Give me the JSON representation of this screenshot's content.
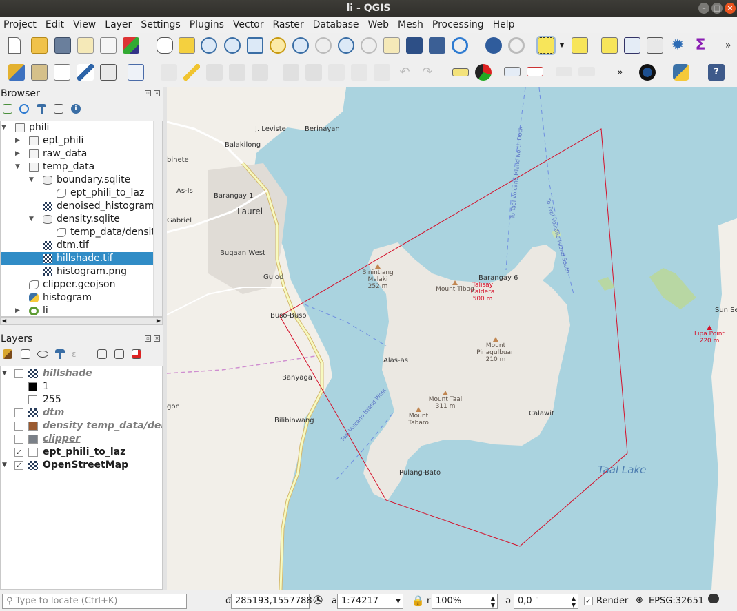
{
  "window": {
    "title": "li - QGIS"
  },
  "menu": [
    "Project",
    "Edit",
    "View",
    "Layer",
    "Settings",
    "Plugins",
    "Vector",
    "Raster",
    "Database",
    "Web",
    "Mesh",
    "Processing",
    "Help"
  ],
  "browser": {
    "title": "Browser",
    "items": [
      {
        "label": "phili",
        "icon": "folder-icon",
        "expand": "▼"
      },
      {
        "label": "ept_phili",
        "icon": "folder-icon",
        "expand": "▶"
      },
      {
        "label": "raw_data",
        "icon": "folder-icon",
        "expand": "▶"
      },
      {
        "label": "temp_data",
        "icon": "folder-icon",
        "expand": "▼"
      },
      {
        "label": "boundary.sqlite",
        "icon": "database-icon",
        "expand": "▼"
      },
      {
        "label": "ept_phili_to_laz",
        "icon": "polygon-layer-icon",
        "expand": ""
      },
      {
        "label": "denoised_histogram",
        "icon": "raster-icon",
        "expand": ""
      },
      {
        "label": "density.sqlite",
        "icon": "database-icon",
        "expand": "▼"
      },
      {
        "label": "temp_data/density",
        "icon": "polygon-layer-icon",
        "expand": ""
      },
      {
        "label": "dtm.tif",
        "icon": "raster-icon",
        "expand": ""
      },
      {
        "label": "hillshade.tif",
        "icon": "raster-icon",
        "expand": "",
        "selected": true
      },
      {
        "label": "histogram.png",
        "icon": "raster-icon",
        "expand": ""
      },
      {
        "label": "clipper.geojson",
        "icon": "polygon-layer-icon",
        "expand": ""
      },
      {
        "label": "histogram",
        "icon": "python-icon",
        "expand": ""
      },
      {
        "label": "li",
        "icon": "qgis-icon",
        "expand": "▶"
      }
    ]
  },
  "layers": {
    "title": "Layers",
    "items": [
      {
        "label": "hillshade",
        "checked": false,
        "style": "italic bold",
        "icon": "raster-icon"
      },
      {
        "label": "1",
        "legend": "#000000"
      },
      {
        "label": "255",
        "legend": "#ffffff"
      },
      {
        "label": "dtm",
        "checked": false,
        "style": "italic bold",
        "icon": "raster-icon"
      },
      {
        "label": "density temp_data/density",
        "checked": false,
        "style": "italic bold",
        "icon": "fill-#9a5a30"
      },
      {
        "label": "clipper",
        "checked": false,
        "style": "italic bold underline",
        "icon": "fill-#7a8088"
      },
      {
        "label": "ept_phili_to_laz",
        "checked": true,
        "style": "bold",
        "icon": "fill-#ffffff"
      },
      {
        "label": "OpenStreetMap",
        "checked": true,
        "style": "bold",
        "icon": "raster-icon"
      }
    ]
  },
  "status": {
    "locator_placeholder": "Type to locate (Ctrl+K)",
    "coordinate": "285193,1557788",
    "scale": "1:74217",
    "magnifier": "100%",
    "rotation": "0,0 °",
    "render_label": "Render",
    "crs": "EPSG:32651"
  },
  "map": {
    "labels": [
      "J. Leviste",
      "Berinayan",
      "Balakilong",
      "binete",
      "As-Is",
      "Barangay 1",
      "Laurel",
      "Gabriel",
      "Bugaan West",
      "Gulod",
      "Buso-Buso",
      "Alas-as",
      "Banyaga",
      "gon",
      "Bilibinwang",
      "Pulang-Bato",
      "Calawit",
      "Barangay 6",
      "Sun Se",
      "To Taal Volcano Island North Dock",
      "To Taal Volcano Island South",
      "Taal Volcano Island West"
    ],
    "peaks": [
      {
        "name": "Binintiang Malaki",
        "elev": "252 m"
      },
      {
        "name": "Mount Tibag",
        "elev": ""
      },
      {
        "name": "Talisay Caldera",
        "elev": "500 m",
        "red": true
      },
      {
        "name": "Mount Pinagulbuan",
        "elev": "210 m"
      },
      {
        "name": "Mount Taal",
        "elev": "311 m"
      },
      {
        "name": "Mount Tabaro",
        "elev": ""
      },
      {
        "name": "Lipa Point",
        "elev": "220 m",
        "red": true
      }
    ],
    "lake_label": "Taal Lake",
    "colors": {
      "water": "#aad3df",
      "land": "#f2efe9",
      "island": "#ebe8e2",
      "road": "#f7fabf",
      "boundary": "#d5102a"
    }
  }
}
